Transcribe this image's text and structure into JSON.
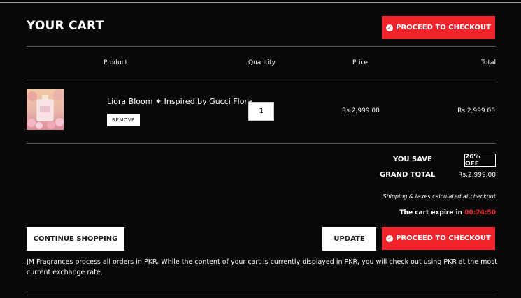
{
  "cart": {
    "title": "YOUR CART",
    "checkout_label": "PROCEED TO CHECKOUT",
    "columns": {
      "product": "Product",
      "quantity": "Quantity",
      "price": "Price",
      "total": "Total"
    },
    "items": [
      {
        "name": "Liora Bloom ✦ Inspired by Gucci Flora",
        "remove_label": "REMOVE",
        "quantity": "1",
        "price": "Rs.2,999.00",
        "total": "Rs.2,999.00"
      }
    ],
    "summary": {
      "you_save_label": "YOU SAVE",
      "you_save_value": "26% OFF",
      "grand_total_label": "GRAND TOTAL",
      "grand_total_value": "Rs.2,999.00",
      "shipping_note": "Shipping & taxes calculated at checkout",
      "expire_label": "The cart expire in",
      "expire_timer": "00:24:50"
    },
    "buttons": {
      "continue_shopping": "CONTINUE SHOPPING",
      "update": "UPDATE",
      "checkout": "PROCEED TO CHECKOUT"
    },
    "currency_note": "JM Fragrances process all orders in PKR. While the content of your cart is currently displayed in PKR, you will check out using PKR at the most current exchange rate."
  },
  "colors": {
    "accent": "#f2232b",
    "background": "#080808",
    "text": "#ffffff"
  },
  "icons": {
    "checkout": "check-circle-icon"
  }
}
